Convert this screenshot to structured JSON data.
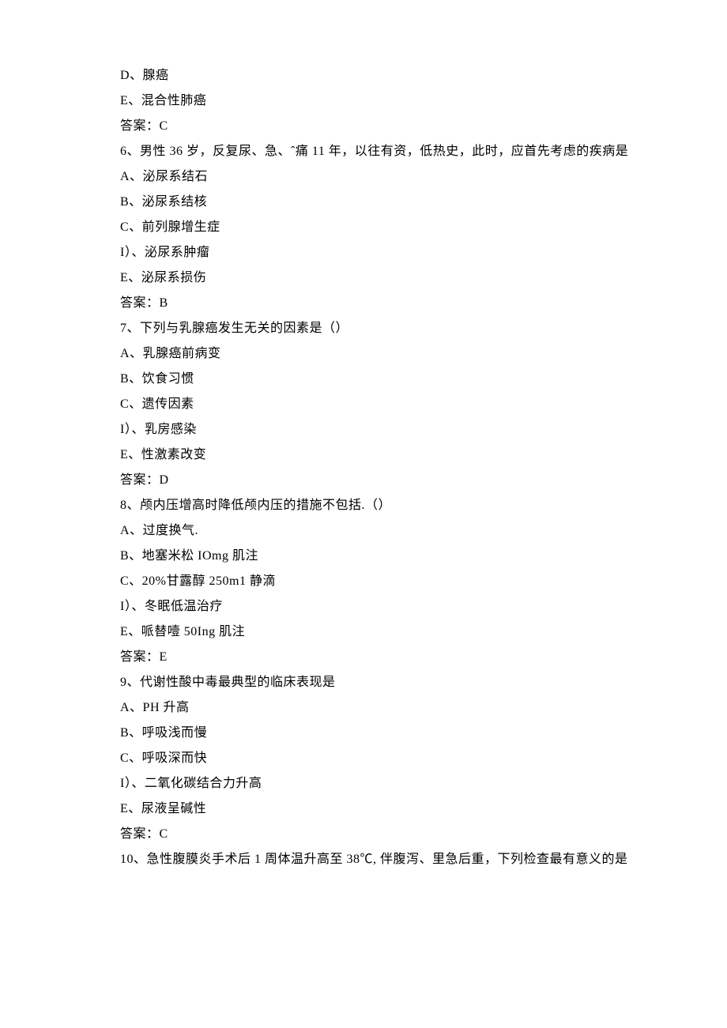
{
  "lines": [
    "D、腺癌",
    "E、混合性肺癌",
    "答案：C",
    "6、男性 36 岁，反复尿、急、ˆ痛 11 年，以往有资，低热史，此时，应首先考虑的疾病是",
    "A、泌尿系结石",
    "B、泌尿系结核",
    "C、前列腺增生症",
    "I）、泌尿系肿瘤",
    "E、泌尿系损伤",
    "答案：B",
    "7、下列与乳腺癌发生无关的因素是（）",
    "A、乳腺癌前病变",
    "B、饮食习惯",
    "C、遗传因素",
    "I）、乳房感染",
    "E、性激素改变",
    "答案：D",
    "8、颅内压增高时降低颅内压的措施不包括.（）",
    "A、过度换气.",
    "B、地塞米松 IOmg 肌注",
    "C、20%甘露醇 250m1 静滴",
    "I）、冬眠低温治疗",
    "E、哌替噎 50Ing 肌注",
    "答案：E",
    "9、代谢性酸中毒最典型的临床表现是",
    "A、PH 升高",
    "B、呼吸浅而慢",
    "C、呼吸深而快",
    "I）、二氧化碳结合力升高",
    "E、尿液呈碱性",
    "答案：C",
    "10、急性腹膜炎手术后 1 周体温升高至 38℃, 伴腹泻、里急后重，下列检查最有意义的是"
  ],
  "wrapIndices": [
    3,
    31
  ]
}
